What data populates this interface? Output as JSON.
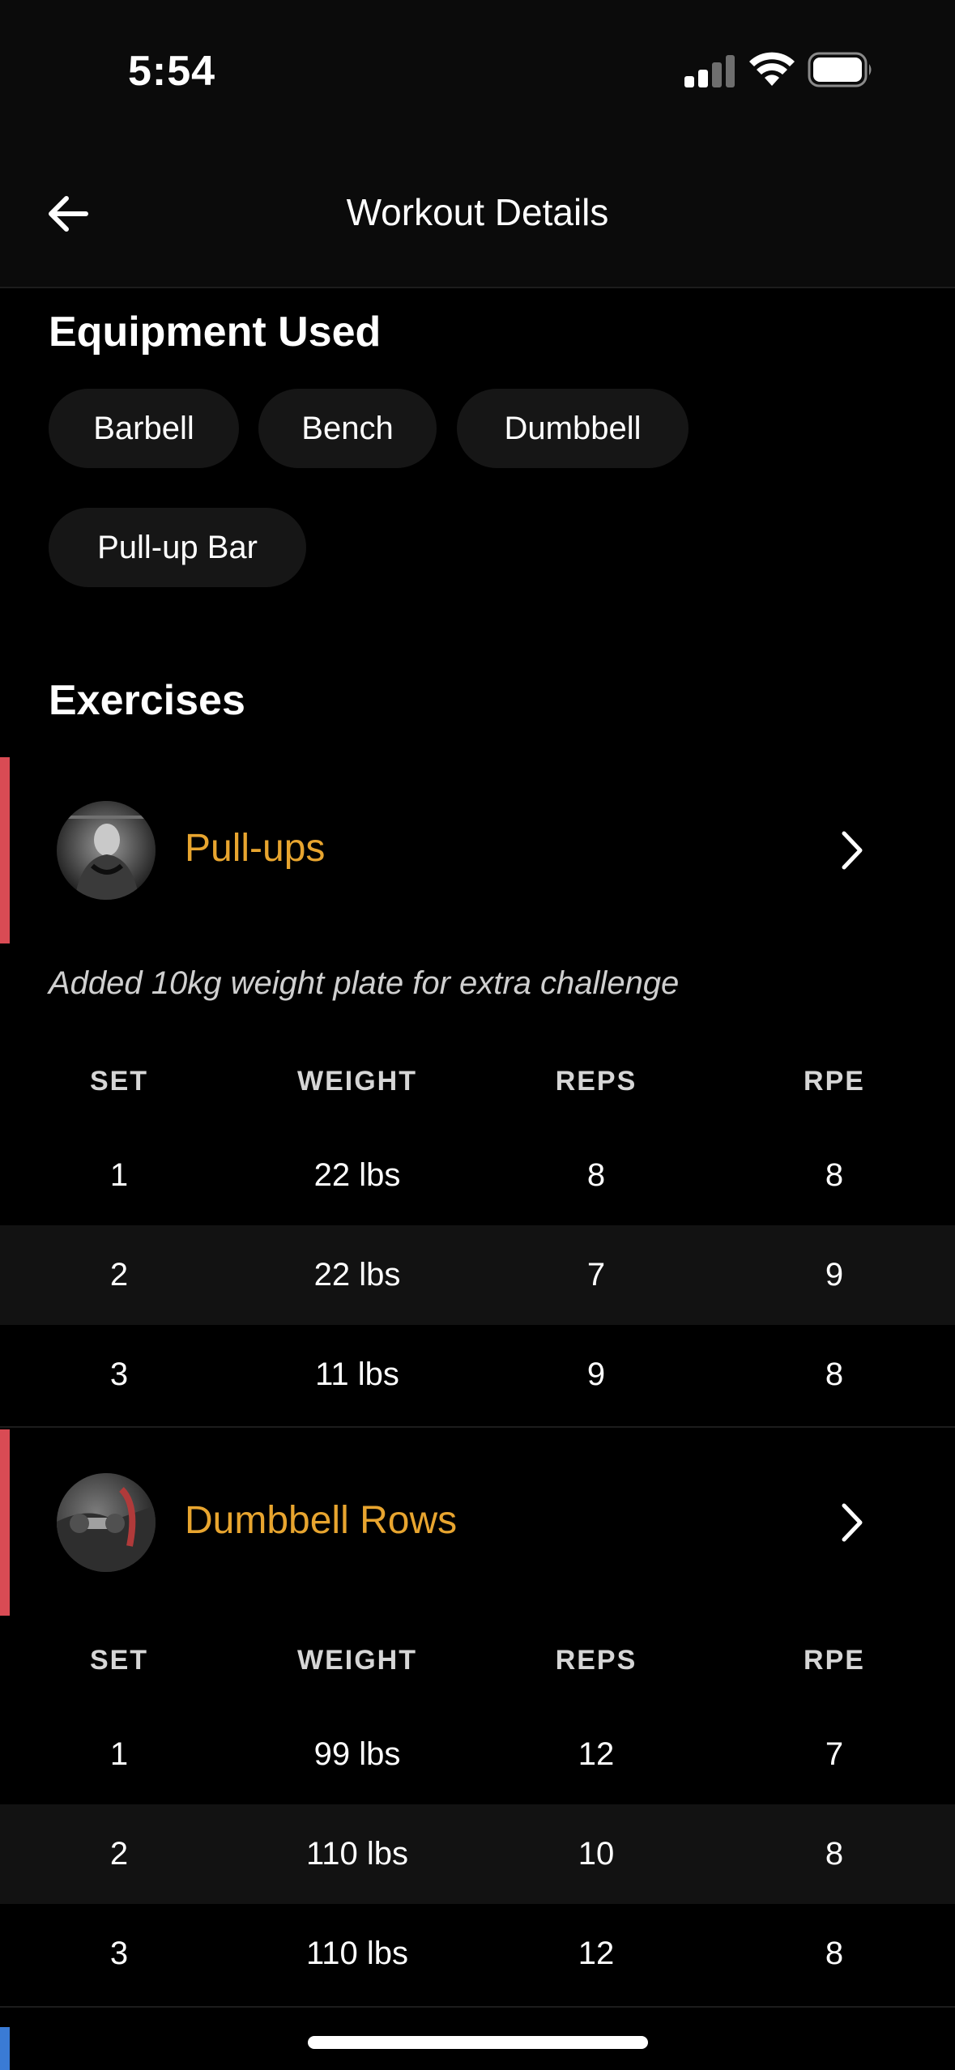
{
  "status": {
    "time": "5:54"
  },
  "header": {
    "title": "Workout Details"
  },
  "equipment": {
    "title": "Equipment Used",
    "chips": [
      "Barbell",
      "Bench",
      "Dumbbell",
      "Pull-up Bar"
    ]
  },
  "exercises_section": {
    "title": "Exercises"
  },
  "table_headers": {
    "set": "SET",
    "weight": "WEIGHT",
    "reps": "REPS",
    "rpe": "RPE"
  },
  "exercises": [
    {
      "name": "Pull-ups",
      "note": "Added 10kg weight plate for extra challenge",
      "sets": [
        {
          "set": "1",
          "weight": "22 lbs",
          "reps": "8",
          "rpe": "8"
        },
        {
          "set": "2",
          "weight": "22 lbs",
          "reps": "7",
          "rpe": "9"
        },
        {
          "set": "3",
          "weight": "11 lbs",
          "reps": "9",
          "rpe": "8"
        }
      ]
    },
    {
      "name": "Dumbbell Rows",
      "sets": [
        {
          "set": "1",
          "weight": "99 lbs",
          "reps": "12",
          "rpe": "7"
        },
        {
          "set": "2",
          "weight": "110 lbs",
          "reps": "10",
          "rpe": "8"
        },
        {
          "set": "3",
          "weight": "110 lbs",
          "reps": "12",
          "rpe": "8"
        }
      ]
    }
  ],
  "colors": {
    "accent_exercise": "#e8a52f",
    "accent_bar": "#d94b54",
    "next_bar": "#3a7bd5",
    "background": "#000000"
  },
  "icons": [
    "back-arrow-icon",
    "chevron-right-icon",
    "signal-icon",
    "wifi-icon",
    "battery-icon"
  ]
}
